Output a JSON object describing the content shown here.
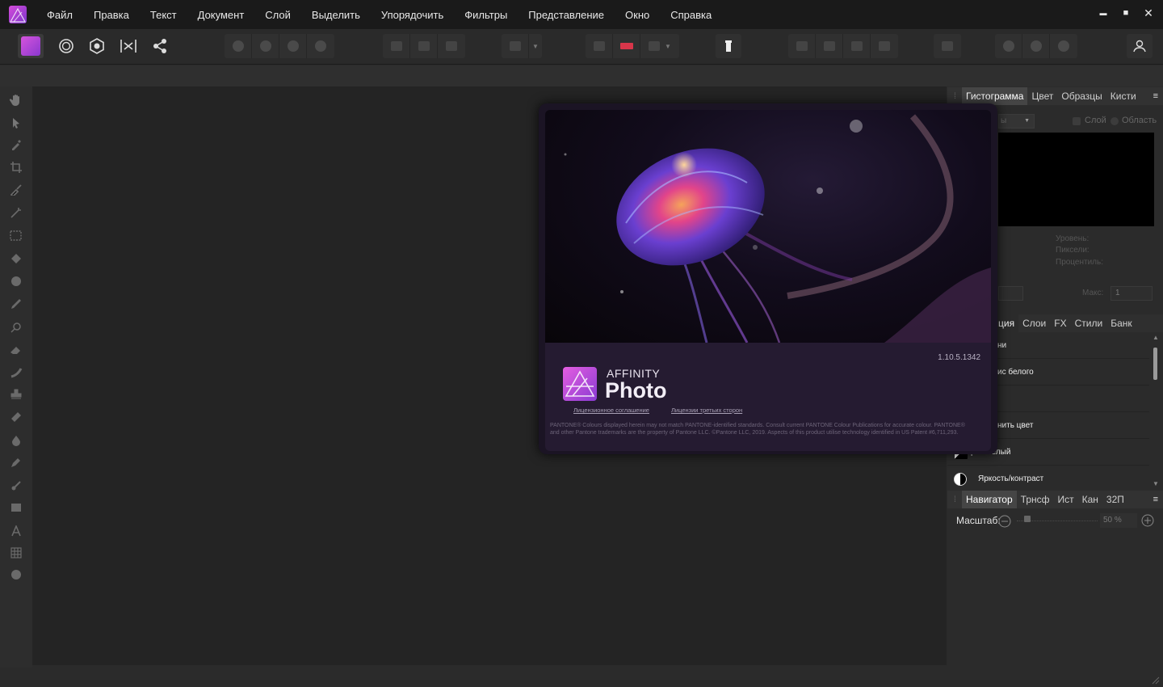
{
  "menubar": {
    "items": [
      "Файл",
      "Правка",
      "Текст",
      "Документ",
      "Слой",
      "Выделить",
      "Упорядочить",
      "Фильтры",
      "Представление",
      "Окно",
      "Справка"
    ],
    "window_controls": {
      "minimize": "▬",
      "maximize": "■",
      "close": "✕"
    }
  },
  "colors": {
    "accent": "#c95bd8",
    "menubar_bg": "#1a1a1a",
    "canvas_bg": "#242424",
    "panel_bg": "#2b2b2b"
  },
  "histogram_panel": {
    "tabs": [
      "Гистограмма",
      "Цвет",
      "Образцы",
      "Кисти"
    ],
    "active_tab": "Гистограмма",
    "dropdown_partial": "ы",
    "checkbox_layer": "Слой",
    "checkbox_area": "Область",
    "stats": [
      "Уровень:",
      "Пиксели:",
      "Процентиль:"
    ],
    "max_label": "Макс:",
    "max_value": "1"
  },
  "adjustments_panel": {
    "tabs": [
      "ция",
      "Слои",
      "FX",
      "Стили",
      "Банк"
    ],
    "items": [
      {
        "label": "ни",
        "icon": "blank"
      },
      {
        "label": "ис белого",
        "icon": "blank"
      },
      {
        "label": "",
        "icon": "blank"
      },
      {
        "label": "нить цвет",
        "icon": "blank"
      },
      {
        "label": "рно-белый",
        "icon": "bw-icon"
      },
      {
        "label": "Яркость/контраст",
        "icon": "brightness-icon"
      }
    ]
  },
  "navigator_panel": {
    "tabs": [
      "Навигатор",
      "Трнсф",
      "Ист",
      "Кан",
      "32П"
    ],
    "active_tab": "Навигатор",
    "zoom_label": "Масштаб:",
    "zoom_value": "50 %",
    "zoom_fraction": 0.1
  },
  "splash": {
    "version": "1.10.5.1342",
    "brand_top": "AFFINITY",
    "brand_main": "Photo",
    "link_license": "Лицензионное соглашение",
    "link_third_party": "Лицензии третьих сторон",
    "legal": "PANTONE® Colours displayed herein may not match PANTONE-identified standards. Consult current PANTONE Colour Publications for accurate colour. PANTONE® and other Pantone trademarks are the property of Pantone LLC. ©Pantone LLC, 2019. Aspects of this product utilise technology identified in US Patent #6,711,293."
  }
}
